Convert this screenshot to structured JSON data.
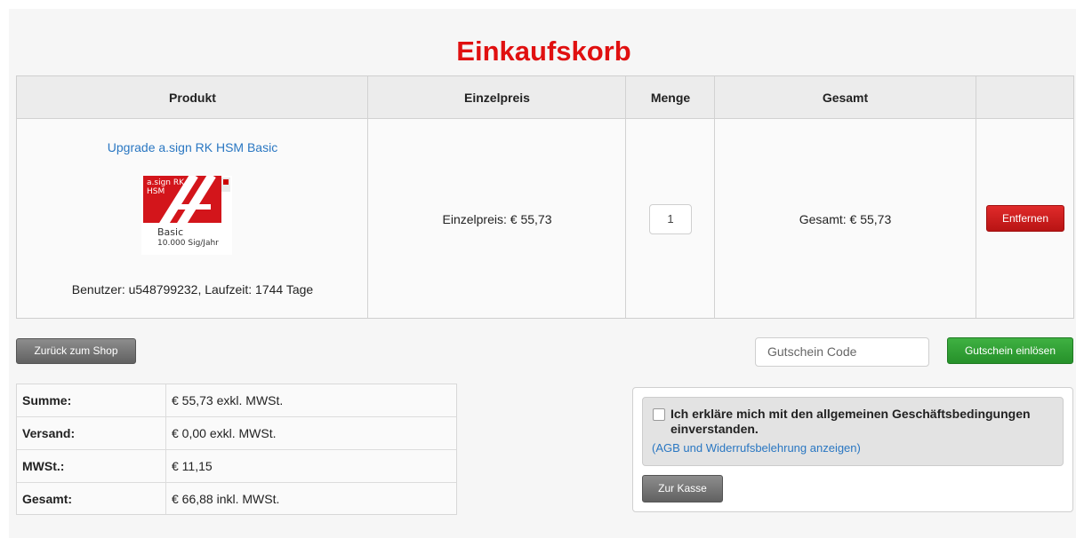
{
  "page": {
    "title": "Einkaufskorb"
  },
  "cart": {
    "headers": {
      "product": "Produkt",
      "unit_price": "Einzelpreis",
      "quantity": "Menge",
      "total": "Gesamt"
    },
    "items": [
      {
        "name": "Upgrade a.sign RK HSM Basic",
        "image_text": {
          "line1": "a.sign RK",
          "line2": "HSM",
          "caption1": "Basic",
          "caption2": "10.000 Sig/Jahr"
        },
        "meta": "Benutzer: u548799232, Laufzeit: 1744 Tage",
        "unit_price": "Einzelpreis: € 55,73",
        "quantity": "1",
        "total": "Gesamt: € 55,73",
        "remove_label": "Entfernen"
      }
    ]
  },
  "actions": {
    "back_label": "Zurück zum Shop",
    "coupon_placeholder": "Gutschein Code",
    "coupon_button": "Gutschein einlösen"
  },
  "summary": [
    {
      "label": "Summe:",
      "value": "€ 55,73 exkl. MWSt."
    },
    {
      "label": "Versand:",
      "value": "€ 0,00 exkl. MWSt."
    },
    {
      "label": "MWSt.:",
      "value": "€ 11,15"
    },
    {
      "label": "Gesamt:",
      "value": "€ 66,88 inkl. MWSt."
    }
  ],
  "checkout": {
    "terms_text": "Ich erkläre mich mit den allgemeinen Geschäftsbedingungen einverstanden.",
    "terms_link": "(AGB und Widerrufsbelehrung anzeigen)",
    "terms_checked": false,
    "button_label": "Zur Kasse"
  },
  "colors": {
    "title": "#e01010",
    "link": "#2a77c2",
    "remove_button": "#c81c1c",
    "coupon_button": "#2f9f32",
    "neutral_button": "#777777"
  },
  "icons": {
    "product_image": "a-sign-rk-hsm-logo",
    "checkbox": "checkbox-icon"
  }
}
